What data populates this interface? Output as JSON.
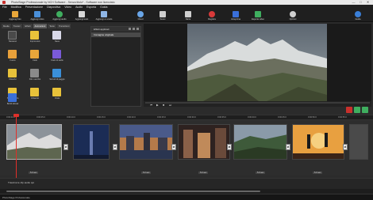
{
  "window": {
    "title": "PhotoStage Professionale by NCH Software - Senza titolo* - Software non licenziato",
    "min": "—",
    "max": "□",
    "close": "✕"
  },
  "menu": [
    "File",
    "Modifica",
    "Presentazione",
    "Diapositiva",
    "Video",
    "Audio",
    "Esporta",
    "Guida"
  ],
  "toolbar": {
    "left": [
      {
        "label": "Aggiungi foto",
        "icon": "add-photo-icon",
        "color": "#e8a63a"
      },
      {
        "label": "Aggiungi video",
        "icon": "add-video-icon",
        "color": "#4a8fd8"
      },
      {
        "label": "Aggiungi audio",
        "icon": "add-audio-icon",
        "color": "#3fae5f"
      },
      {
        "label": "Aggiungi testo",
        "icon": "add-text-icon",
        "color": "#d8d8d8"
      },
      {
        "label": "Aggiungi un vuoto",
        "icon": "add-blank-icon",
        "color": "#8fb6e6"
      },
      {
        "label": "Cloud",
        "icon": "cloud-icon",
        "color": "#6aa6e8"
      }
    ],
    "right": [
      {
        "label": "Suoni",
        "icon": "sounds-icon",
        "color": "#cfcfcf"
      },
      {
        "label": "Narra",
        "icon": "narrate-icon",
        "color": "#cfcfcf"
      },
      {
        "label": "Registra",
        "icon": "record-icon",
        "color": "#d83a3a"
      },
      {
        "label": "Anteprima",
        "icon": "preview-icon",
        "color": "#3a6fd8"
      },
      {
        "label": "Esporta video",
        "icon": "export-icon",
        "color": "#3fae5f"
      },
      {
        "label": "Opzioni",
        "icon": "options-icon",
        "color": "#cfcfcf"
      },
      {
        "label": "Guida",
        "icon": "help-icon",
        "color": "#3a7fd8"
      }
    ]
  },
  "tabs": [
    {
      "label": "Media",
      "active": false
    },
    {
      "label": "Transiz.",
      "active": false
    },
    {
      "label": "Effetti",
      "active": false
    },
    {
      "label": "Animazioni",
      "active": true
    },
    {
      "label": "Testo",
      "active": false
    },
    {
      "label": "Transizioni",
      "active": false
    }
  ],
  "effects": [
    {
      "label": "Nessuno",
      "color": "#4a4a4a",
      "icon": "none-icon"
    },
    {
      "label": "Improvviso",
      "color": "#e8c23a",
      "icon": "star-icon"
    },
    {
      "label": "Neve",
      "color": "#d8d8e8",
      "icon": "snow-icon"
    },
    {
      "label": "Fuoco",
      "color": "#e8a03a",
      "icon": "fire-icon"
    },
    {
      "label": "Cielo",
      "color": "#e8a63a",
      "icon": "sky-icon"
    },
    {
      "label": "Cielo di stelle",
      "color": "#7a5ad8",
      "icon": "stars-icon"
    },
    {
      "label": "Dissolvi",
      "color": "#e8c23a",
      "icon": "dissolve-icon"
    },
    {
      "label": "Film vecchio",
      "color": "#8a8a8a",
      "icon": "old-film-icon"
    },
    {
      "label": "Sorvoli di paggio",
      "color": "#3a8fd8",
      "icon": "flyby-icon"
    },
    {
      "label": "Sovrapposto",
      "color": "#e8c23a",
      "icon": "overlay-icon"
    },
    {
      "label": "Ghiaccio",
      "color": "#e8c23a",
      "icon": "ice-icon"
    },
    {
      "label": "Onde",
      "color": "#e8c23a",
      "icon": "waves-icon"
    },
    {
      "label": "Bordi sfocati",
      "color": "#3a6fd8",
      "icon": "blur-edges-icon"
    }
  ],
  "applied": {
    "header": "Effetti applicati",
    "item": "Immagine originale"
  },
  "controls": {
    "play": "▶",
    "stop": "■",
    "prev": "⏮",
    "next": "⏭"
  },
  "ruler": [
    "0:00:00.0",
    "0:00:05.0",
    "0:00:10.0",
    "0:00:15.0",
    "0:00:20.0",
    "0:00:25.0",
    "0:00:30.0",
    "0:00:35.0",
    "0:00:40.0",
    "0:00:45.0",
    "0:00:50.0",
    "0:00:55.0"
  ],
  "clips": [
    {
      "label": "5.0 sec",
      "selected": true
    },
    {
      "label": "",
      "selected": false
    },
    {
      "label": "5.0 sec",
      "selected": false
    },
    {
      "label": "5.0 sec",
      "selected": false
    },
    {
      "label": "5.0 sec",
      "selected": false
    },
    {
      "label": "5.0 sec",
      "selected": false
    },
    {
      "label": "5.0 sec",
      "selected": false
    }
  ],
  "audio_hint": "Trascina le clip audio qui",
  "status": "PhotoStage Professionale",
  "colors": {
    "accent": "#e0302a",
    "selected": "#8c8c8c"
  }
}
